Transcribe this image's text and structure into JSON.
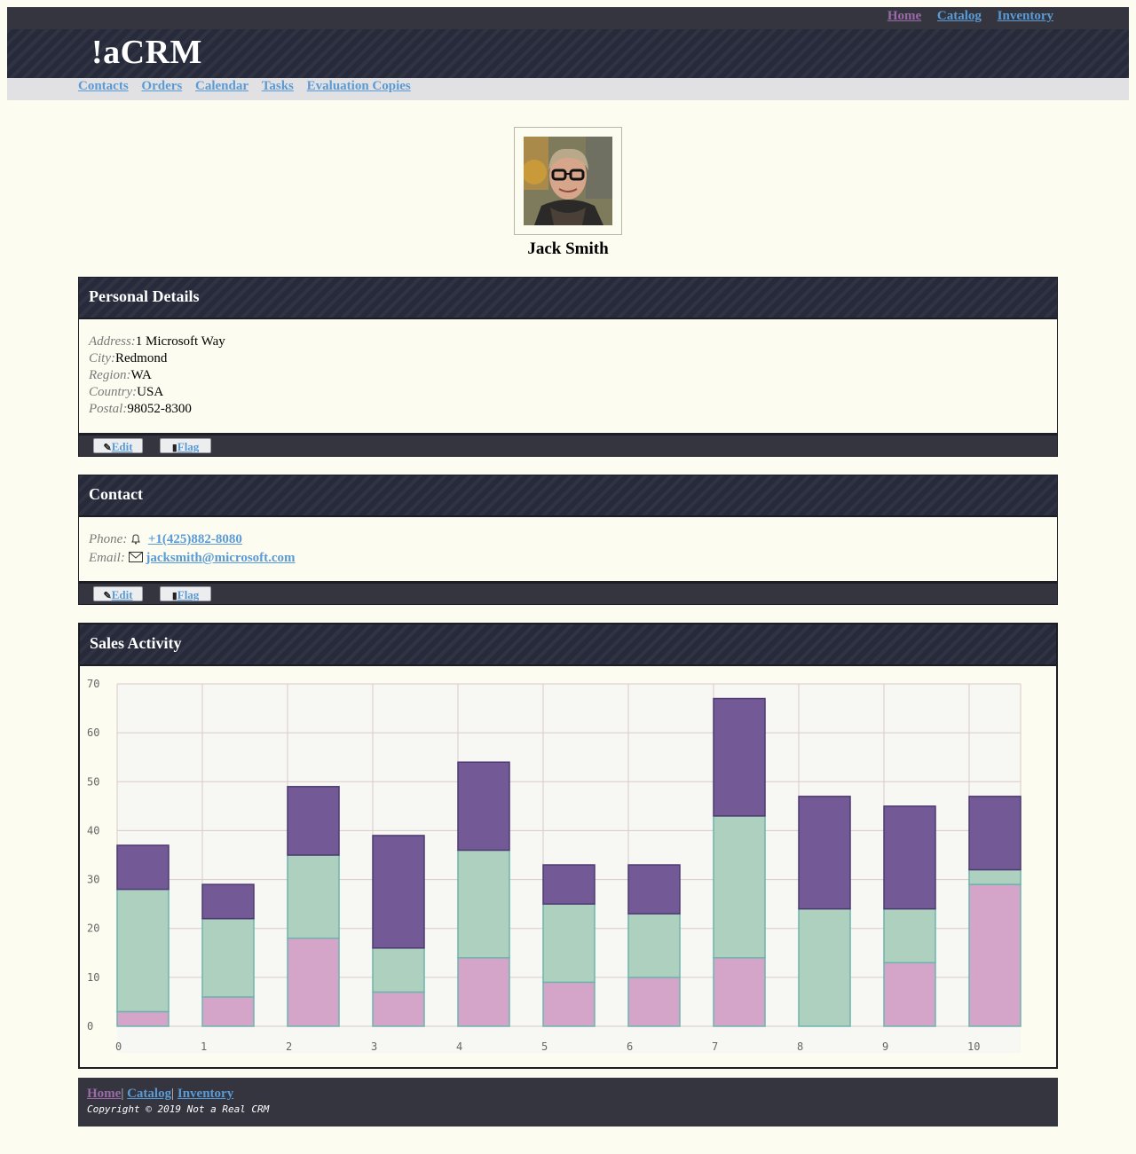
{
  "header": {
    "top_nav": [
      "Home",
      "Catalog",
      "Inventory"
    ],
    "brand": "!aCRM",
    "sub_nav": [
      "Contacts",
      "Orders",
      "Calendar",
      "Tasks",
      "Evaluation Copies"
    ]
  },
  "profile": {
    "name": "Jack Smith"
  },
  "personal": {
    "title": "Personal Details",
    "address_label": "Address:",
    "address": "1 Microsoft Way",
    "city_label": "City:",
    "city": "Redmond",
    "region_label": "Region:",
    "region": "WA",
    "country_label": "Country:",
    "country": "USA",
    "postal_label": "Postal:",
    "postal": "98052-8300",
    "edit_label": "Edit",
    "flag_label": "Flag"
  },
  "contact": {
    "title": "Contact",
    "phone_label": "Phone:",
    "phone": "+1(425)882-8080",
    "email_label": "Email:",
    "email": "jacksmith@microsoft.com",
    "edit_label": "Edit",
    "flag_label": "Flag"
  },
  "sales": {
    "title": "Sales Activity"
  },
  "chart_data": {
    "type": "bar",
    "stacked": true,
    "categories": [
      "0",
      "1",
      "2",
      "3",
      "4",
      "5",
      "6",
      "7",
      "8",
      "9",
      "10"
    ],
    "series": [
      {
        "values": [
          3,
          6,
          18,
          7,
          14,
          9,
          10,
          14,
          0,
          13,
          29
        ],
        "color": "#d4a5c9"
      },
      {
        "values": [
          25,
          16,
          17,
          9,
          22,
          16,
          13,
          29,
          24,
          11,
          3
        ],
        "color": "#aed0be"
      },
      {
        "values": [
          9,
          7,
          14,
          23,
          18,
          8,
          10,
          24,
          23,
          21,
          15
        ],
        "color": "#735a97"
      }
    ],
    "ylim": [
      0,
      70
    ],
    "yticks": [
      0,
      10,
      20,
      30,
      40,
      50,
      60,
      70
    ],
    "grid": true
  },
  "footer": {
    "links": [
      "Home",
      "Catalog",
      "Inventory"
    ],
    "copyright": "Copyright © 2019 Not a Real CRM"
  }
}
